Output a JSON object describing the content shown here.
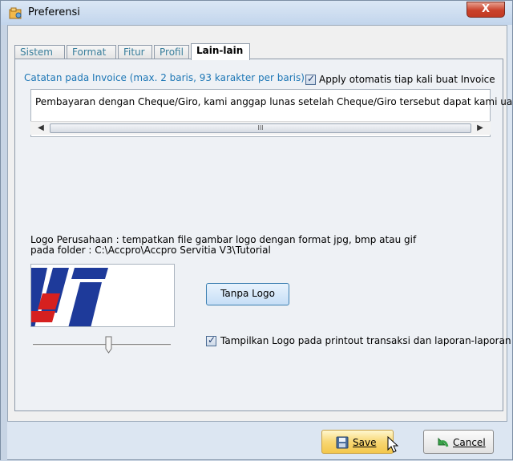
{
  "window": {
    "title": "Preferensi",
    "close_label": "X"
  },
  "tabs": [
    {
      "label": "Sistem"
    },
    {
      "label": "Format"
    },
    {
      "label": "Fitur"
    },
    {
      "label": "Profil"
    },
    {
      "label": "Lain-lain"
    }
  ],
  "active_tab": "Lain-lain",
  "invoice_notes": {
    "label": "Catatan pada Invoice (max. 2 baris, 93 karakter per baris)",
    "auto_apply_label": "Apply otomatis tiap kali buat Invoice",
    "auto_apply_checked": true,
    "text": "Pembayaran dengan Cheque/Giro, kami anggap lunas setelah Cheque/Giro tersebut dapat kami ua",
    "scroll_thumb_glyph": "III"
  },
  "logo": {
    "description_line1": "Logo Perusahaan : tempatkan file gambar logo dengan format jpg, bmp atau gif",
    "description_line2": "pada folder : C:\\Accpro\\Accpro Servitia V3\\Tutorial",
    "no_logo_button": "Tanpa Logo",
    "show_on_print_label": "Tampilkan Logo pada printout transaksi dan laporan-laporan",
    "show_on_print_checked": true
  },
  "footer": {
    "save_label": "Save",
    "cancel_label": "Cancel"
  },
  "colors": {
    "accent_text": "#1c76b5",
    "logo_blue": "#1e3a9a",
    "logo_red": "#d6201f"
  }
}
